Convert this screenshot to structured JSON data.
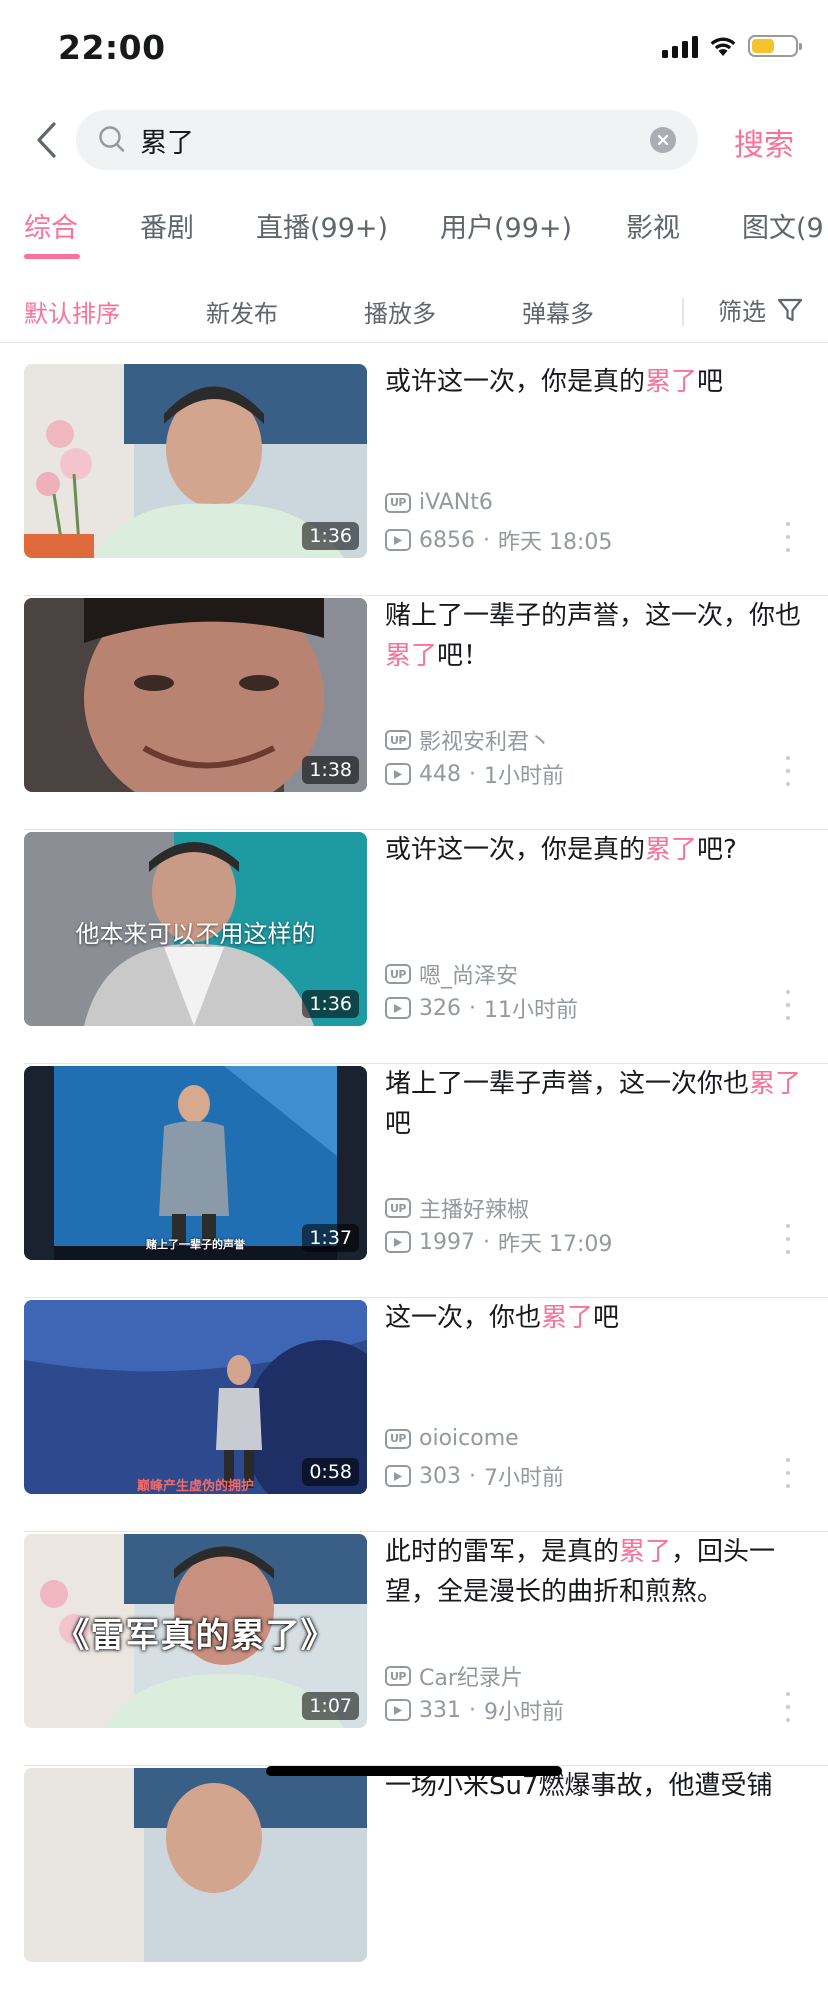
{
  "status_bar": {
    "time": "22:00",
    "battery_color": "#f5c32c"
  },
  "search": {
    "query": "累了",
    "submit_label": "搜索"
  },
  "tabs": [
    {
      "label": "综合",
      "active": true
    },
    {
      "label": "番剧"
    },
    {
      "label": "直播(99+)"
    },
    {
      "label": "用户(99+)"
    },
    {
      "label": "影视"
    },
    {
      "label": "图文(9"
    }
  ],
  "sort": {
    "options": [
      "默认排序",
      "新发布",
      "播放多",
      "弹幕多"
    ],
    "filter_label": "筛选"
  },
  "theme": {
    "accent": "#fb7299",
    "text_primary": "#18191c",
    "text_secondary": "#9499a0"
  },
  "results": [
    {
      "title_parts": [
        "或许这一次，你是真的",
        "累了",
        "吧"
      ],
      "uploader": "iVANt6",
      "views": "6856",
      "time": "昨天 18:05",
      "duration": "1:36",
      "thumb_overlay": ""
    },
    {
      "title_parts": [
        "赌上了一辈子的声誉，这一次，你也",
        "累了",
        "吧！"
      ],
      "uploader": "影视安利君丶",
      "views": "448",
      "time": "1小时前",
      "duration": "1:38",
      "thumb_overlay": ""
    },
    {
      "title_parts": [
        "或许这一次，你是真的",
        "累了",
        "吧?"
      ],
      "uploader": "嗯_尚泽安",
      "views": "326",
      "time": "11小时前",
      "duration": "1:36",
      "thumb_overlay": "他本来可以不用这样的"
    },
    {
      "title_parts": [
        "堵上了一辈子声誉，这一次你也",
        "累了",
        "吧"
      ],
      "uploader": "主播好辣椒",
      "views": "1997",
      "time": "昨天 17:09",
      "duration": "1:37",
      "thumb_overlay": "赌上了一辈子的声誉"
    },
    {
      "title_parts": [
        "这一次，你也",
        "累了",
        "吧"
      ],
      "uploader": "oioicome",
      "views": "303",
      "time": "7小时前",
      "duration": "0:58",
      "thumb_overlay": "巅峰产生虚伪的拥护"
    },
    {
      "title_parts": [
        "此时的雷军，是真的",
        "累了",
        "，回头一望，全是漫长的曲折和煎熬。"
      ],
      "uploader": "Car纪录片",
      "views": "331",
      "time": "9小时前",
      "duration": "1:07",
      "thumb_overlay": "《雷军真的累了》"
    },
    {
      "title_parts": [
        "一场小米Su7燃爆事故，他遭受铺",
        "",
        ""
      ],
      "uploader": "",
      "views": "",
      "time": "",
      "duration": "",
      "thumb_overlay": ""
    }
  ]
}
